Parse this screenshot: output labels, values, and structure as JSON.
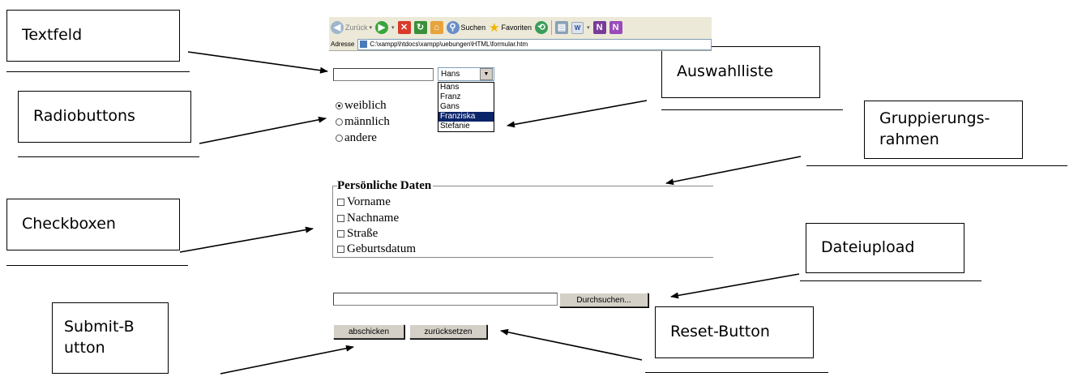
{
  "browser": {
    "toolbar": {
      "back_label": "Zurück",
      "search_label": "Suchen",
      "favorites_label": "Favoriten"
    },
    "address": {
      "label": "Adresse",
      "url": "C:\\xampp\\htdocs\\xampp\\uebungen\\HTML\\formular.htm"
    }
  },
  "form": {
    "select": {
      "selected": "Hans",
      "options": [
        "Hans",
        "Franz",
        "Gans",
        "Franziska",
        "Stefanie"
      ],
      "highlighted_index": 3
    },
    "radios": [
      {
        "label": "weiblich",
        "checked": true
      },
      {
        "label": "männlich",
        "checked": false
      },
      {
        "label": "andere",
        "checked": false
      }
    ],
    "fieldset_legend": "Persönliche Daten",
    "checkboxes": [
      "Vorname",
      "Nachname",
      "Straße",
      "Geburtsdatum"
    ],
    "browse_label": "Durchsuchen...",
    "submit_label": "abschicken",
    "reset_label": "zurücksetzen"
  },
  "callouts": {
    "textfeld": "Textfeld",
    "radiobuttons": "Radiobuttons",
    "checkboxen": "Checkboxen",
    "submit": "Submit-Button",
    "auswahlliste": "Auswahlliste",
    "gruppierungsrahmen": "Gruppierungs-rahmen",
    "dateiupload": "Dateiupload",
    "reset": "Reset-Button"
  },
  "colors": {
    "selection": "#0a246a",
    "chrome": "#ece9d8",
    "button_face": "#d4d0c8"
  }
}
